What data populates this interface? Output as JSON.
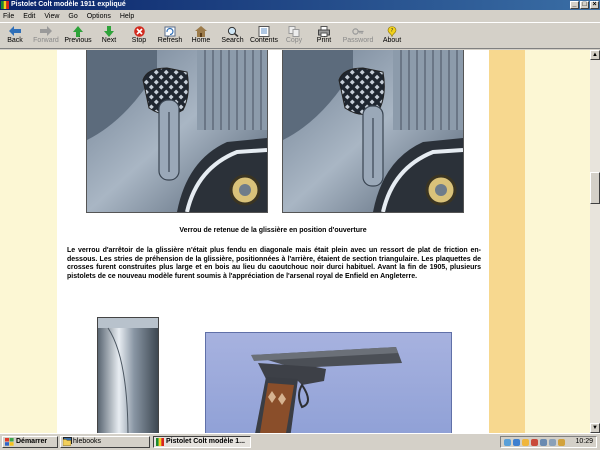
{
  "window": {
    "title": "Pistolet Colt modèle 1911 expliqué"
  },
  "menu": [
    "File",
    "Edit",
    "View",
    "Go",
    "Options",
    "Help"
  ],
  "toolbar": [
    {
      "label": "Back",
      "icon": "back-arrow-icon",
      "disabled": false
    },
    {
      "label": "Forward",
      "icon": "forward-arrow-icon",
      "disabled": true
    },
    {
      "label": "Previous",
      "icon": "previous-icon",
      "disabled": false
    },
    {
      "label": "Next",
      "icon": "next-icon",
      "disabled": false
    },
    {
      "label": "Stop",
      "icon": "stop-icon",
      "disabled": false
    },
    {
      "label": "Refresh",
      "icon": "refresh-icon",
      "disabled": false
    },
    {
      "label": "Home",
      "icon": "home-icon",
      "disabled": false
    },
    {
      "label": "Search",
      "icon": "search-icon",
      "disabled": false
    },
    {
      "label": "Contents",
      "icon": "contents-icon",
      "disabled": false
    },
    {
      "label": "Copy",
      "icon": "copy-icon",
      "disabled": true
    },
    {
      "label": "Print",
      "icon": "print-icon",
      "disabled": false
    },
    {
      "label": "Password",
      "icon": "password-icon",
      "disabled": true
    },
    {
      "label": "About",
      "icon": "about-icon",
      "disabled": false
    }
  ],
  "content": {
    "caption": "Verrou de retenue de la glissière en position d'ouverture",
    "paragraph": "Le verrou d'arrêtoir de la glissière n'était plus fendu en diagonale mais était plein avec un ressort de plat de friction en-dessous. Les stries de préhension de la glissière, positionnées à l'arrière, étaient de section triangulaire. Les plaquettes de crosses furent construites plus large et en bois au lieu du caoutchouc noir durci habituel. Avant la fin de 1905, plusieurs pistolets de ce nouveau modèle furent soumis à l'appréciation de l'arsenal royal de Enfield en Angleterre."
  },
  "taskbar": {
    "start_label": "Démarrer",
    "tasks": [
      {
        "label": "hlebooks",
        "active": false
      },
      {
        "label": "Pistolet Colt modèle 1...",
        "active": true
      }
    ],
    "clock": "10:29"
  },
  "colors": {
    "page_background": "#fcf7d4",
    "side_strip": "#f7d88f",
    "titlebar": "#0a246a"
  }
}
